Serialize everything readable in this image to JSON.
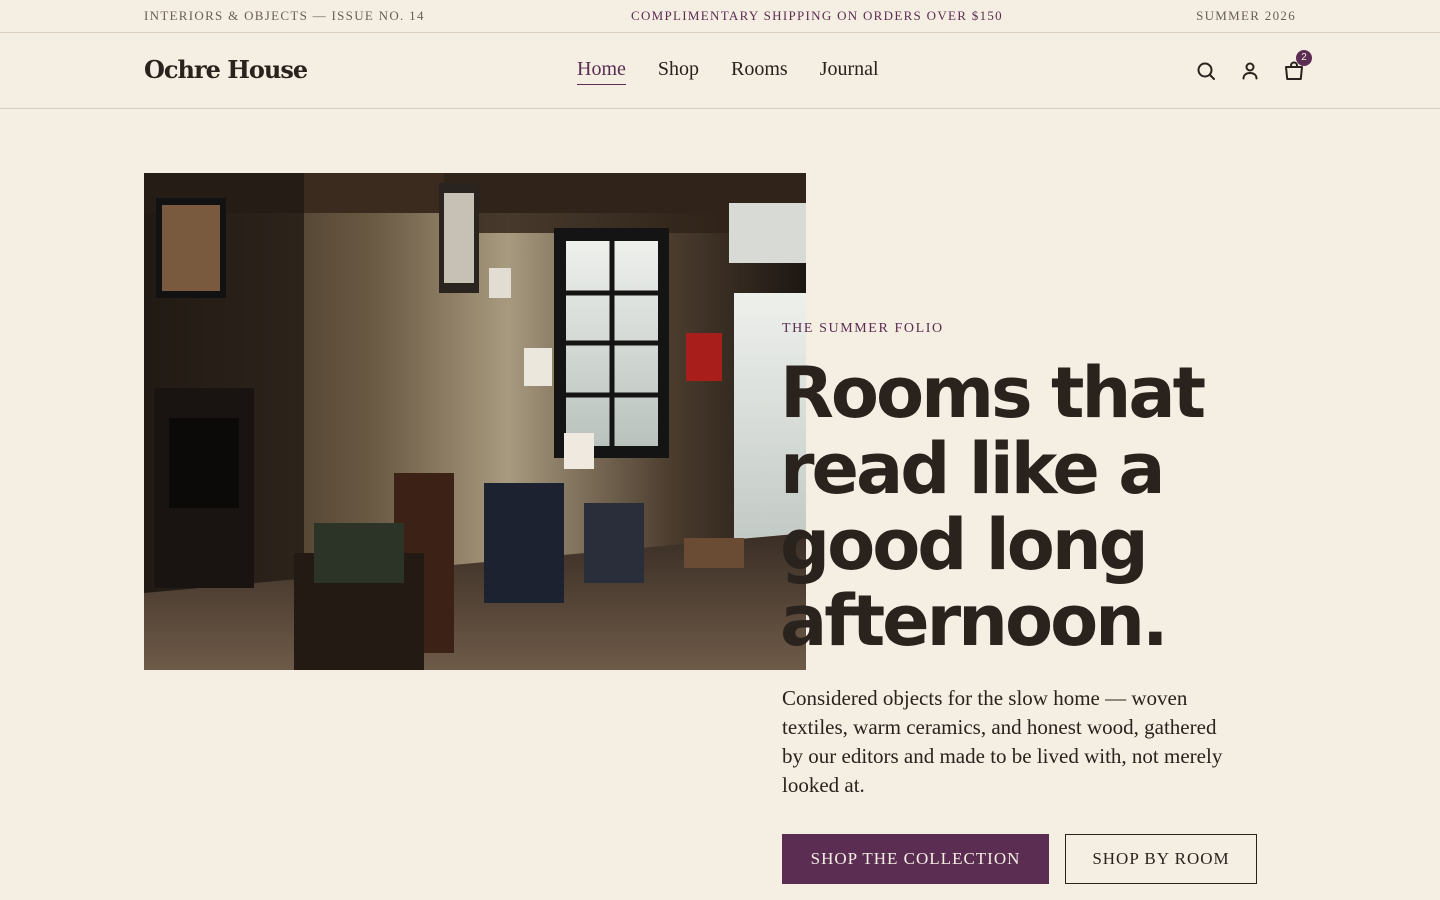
{
  "announcement": {
    "issue": "INTERIORS & OBJECTS — ISSUE NO. 14",
    "promo": "COMPLIMENTARY SHIPPING ON ORDERS OVER $150",
    "season": "SUMMER 2026"
  },
  "header": {
    "logo": "Ochre House",
    "nav": [
      {
        "label": "Home",
        "active": true
      },
      {
        "label": "Shop",
        "active": false
      },
      {
        "label": "Rooms",
        "active": false
      },
      {
        "label": "Journal",
        "active": false
      }
    ],
    "icons": [
      "search-icon",
      "account-icon",
      "cart-icon"
    ],
    "cart_count": "2"
  },
  "hero": {
    "eyebrow": "THE SUMMER FOLIO",
    "headline": "Rooms that read like a good long afternoon.",
    "lede": "Considered objects for the slow home — woven textiles, warm ceramics, and honest wood, gathered by our editors and made to be lived with, not merely looked at.",
    "primary_cta": "SHOP THE COLLECTION",
    "secondary_cta": "SHOP BY ROOM"
  },
  "colors": {
    "background": "#f5eee3",
    "accent": "#5b2d52",
    "text": "#2a221d",
    "rule": "#d9cdbd"
  }
}
